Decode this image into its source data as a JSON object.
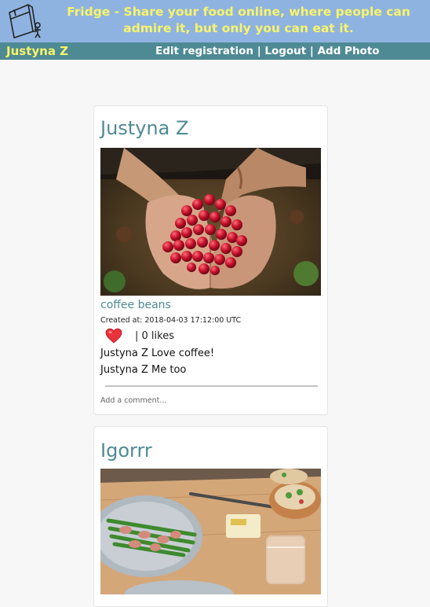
{
  "header": {
    "tagline": "Fridge - Share your food online, where people can admire it, but only you can eat it.",
    "logo_icon": "fridge-icon"
  },
  "nav": {
    "user_name": "Justyna Z",
    "links": {
      "edit": "Edit registration",
      "logout": "Logout",
      "add_photo": "Add Photo",
      "separator": " | "
    }
  },
  "posts": [
    {
      "author": "Justyna Z",
      "caption": "coffee beans",
      "created": "Created at: 2018-04-03 17:12:00 UTC",
      "likes": "| 0 likes",
      "comments": [
        "Justyna Z Love coffee!",
        "Justyna Z Me too"
      ],
      "comment_placeholder": "Add a comment..."
    },
    {
      "author": "Igorrr"
    }
  ],
  "colors": {
    "header_bg": "#8fb3e0",
    "nav_bg": "#4e8a94",
    "accent_yellow": "#f7f46a",
    "title_teal": "#4e8a94",
    "heart_red": "#e8333a"
  }
}
